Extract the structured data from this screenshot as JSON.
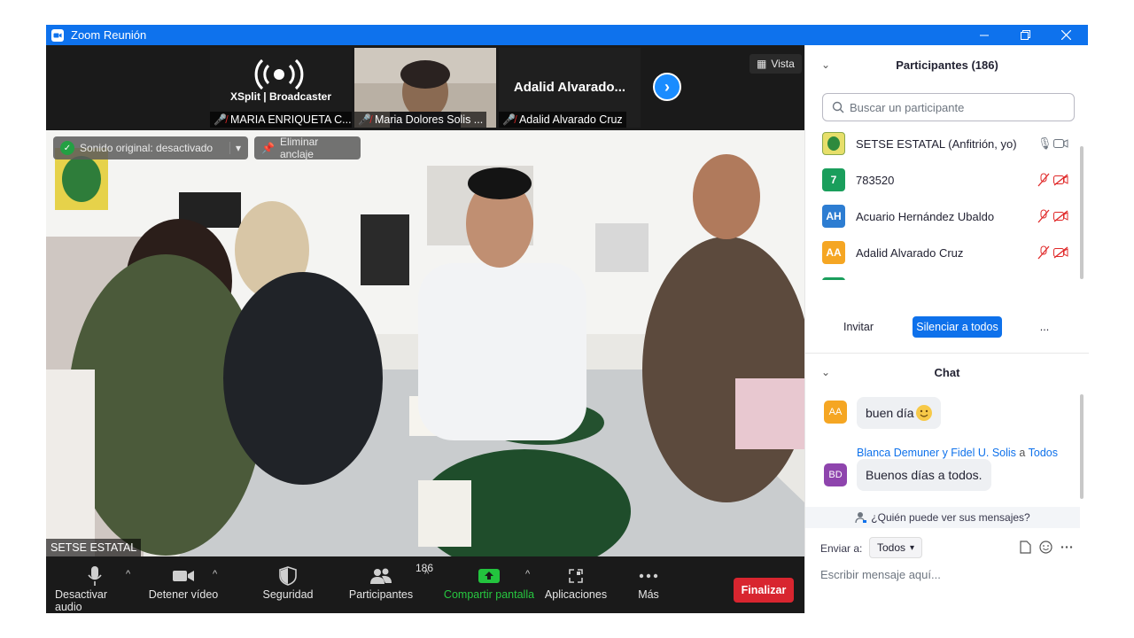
{
  "window": {
    "title": "Zoom Reunión"
  },
  "strip": {
    "thumbnails": [
      {
        "name": "MARIA ENRIQUETA C...",
        "logo_text": "XSplit | Broadcaster"
      },
      {
        "name": "Maria Dolores Solis ..."
      },
      {
        "name": "Adalid Alvarado Cruz",
        "display_text": "Adalid  Alvarado..."
      }
    ],
    "view_label": "Vista"
  },
  "main_video": {
    "label": "SETSE ESTATAL",
    "original_sound": "Sonido original: desactivado",
    "remove_pin": "Eliminar anclaje"
  },
  "toolbar": {
    "mute_label": "Desactivar audio",
    "video_label": "Detener vídeo",
    "security_label": "Seguridad",
    "participants_label": "Participantes",
    "participants_count": "186",
    "share_label": "Compartir pantalla",
    "apps_label": "Aplicaciones",
    "more_label": "Más",
    "end_label": "Finalizar"
  },
  "participants_panel": {
    "title": "Participantes (186)",
    "search_placeholder": "Buscar un participante",
    "participants": [
      {
        "initials": "",
        "name": "SETSE ESTATAL (Anfitrión, yo)",
        "color": "#c9d6a0"
      },
      {
        "initials": "7",
        "name": "783520",
        "color": "#1a9e5c"
      },
      {
        "initials": "AH",
        "name": "Acuario Hernández Ubaldo",
        "color": "#2d7dd2"
      },
      {
        "initials": "AA",
        "name": "Adalid Alvarado Cruz",
        "color": "#f5a623"
      }
    ],
    "invite_label": "Invitar",
    "mute_all_label": "Silenciar a todos",
    "more_label": "..."
  },
  "chat": {
    "title": "Chat",
    "messages": [
      {
        "initials": "AA",
        "avatar_color": "#f5a623",
        "text": "buen día"
      },
      {
        "initials": "BD",
        "avatar_color": "#8e44ad",
        "from": "Blanca Demuner y Fidel U. Solis",
        "to_prefix": "a",
        "to": "Todos",
        "text": "Buenos días a todos."
      }
    ],
    "who_can_see": "¿Quién puede ver sus mensajes?",
    "send_to_label": "Enviar a:",
    "send_to_value": "Todos",
    "compose_placeholder": "Escribir mensaje aquí..."
  }
}
